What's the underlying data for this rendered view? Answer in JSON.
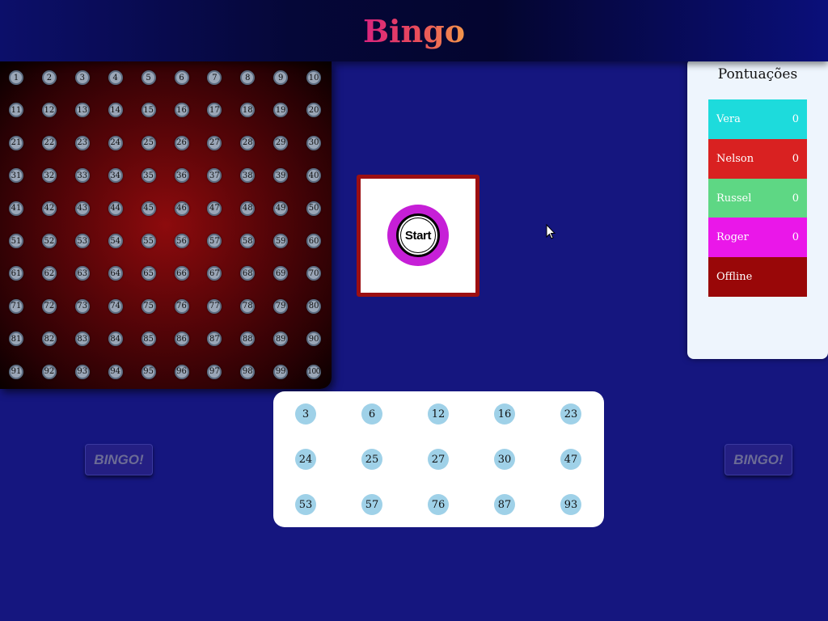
{
  "header": {
    "title": "Bingo"
  },
  "board": {
    "numbers": [
      1,
      2,
      3,
      4,
      5,
      6,
      7,
      8,
      9,
      10,
      11,
      12,
      13,
      14,
      15,
      16,
      17,
      18,
      19,
      20,
      21,
      22,
      23,
      24,
      25,
      26,
      27,
      28,
      29,
      30,
      31,
      32,
      33,
      34,
      35,
      36,
      37,
      38,
      39,
      40,
      41,
      42,
      43,
      44,
      45,
      46,
      47,
      48,
      49,
      50,
      51,
      52,
      53,
      54,
      55,
      56,
      57,
      58,
      59,
      60,
      61,
      62,
      63,
      64,
      65,
      66,
      67,
      68,
      69,
      70,
      71,
      72,
      73,
      74,
      75,
      76,
      77,
      78,
      79,
      80,
      81,
      82,
      83,
      84,
      85,
      86,
      87,
      88,
      89,
      90,
      91,
      92,
      93,
      94,
      95,
      96,
      97,
      98,
      99,
      100
    ]
  },
  "start": {
    "label": "Start"
  },
  "scores": {
    "title": "Pontuações",
    "players": [
      {
        "name": "Vera",
        "score": "0",
        "color": "#1ddbdc"
      },
      {
        "name": "Nelson",
        "score": "0",
        "color": "#d92121"
      },
      {
        "name": "Russel",
        "score": "0",
        "color": "#5ed784"
      },
      {
        "name": "Roger",
        "score": "0",
        "color": "#ea17e9"
      },
      {
        "name": "Offline",
        "score": "",
        "color": "#990708"
      }
    ]
  },
  "card": {
    "numbers": [
      3,
      6,
      12,
      16,
      23,
      24,
      25,
      27,
      30,
      47,
      53,
      57,
      76,
      87,
      93
    ]
  },
  "bingo_left": {
    "label": "BINGO!"
  },
  "bingo_right": {
    "label": "BINGO!"
  },
  "icons": {
    "cursor": "mouse-pointer-icon"
  }
}
